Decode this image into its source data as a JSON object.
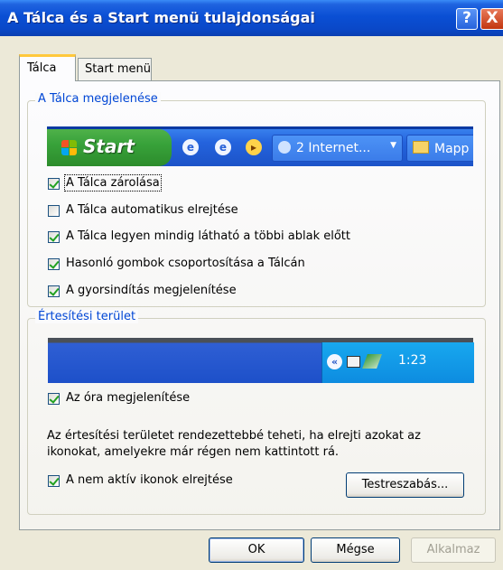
{
  "window": {
    "title": "A Tálca és a Start menü tulajdonságai",
    "help_glyph": "?",
    "close_glyph": "X"
  },
  "tabs": [
    {
      "label": "Tálca",
      "active": true
    },
    {
      "label": "Start menü",
      "active": false
    }
  ],
  "appearance_group": {
    "legend": "A Tálca megjelenése",
    "preview": {
      "start_label": "Start",
      "task_buttons": [
        "2 Internet...",
        "Mapp"
      ]
    },
    "options": [
      {
        "text": "A Tálca zárolása",
        "checked": true
      },
      {
        "text": "A Tálca automatikus elrejtése",
        "checked": false
      },
      {
        "text": "A Tálca legyen mindig látható a többi ablak előtt",
        "checked": true
      },
      {
        "text": "Hasonló gombok csoportosítása a Tálcán",
        "checked": true
      },
      {
        "text": "A gyorsindítás megjelenítése",
        "checked": true
      }
    ]
  },
  "notification_group": {
    "legend": "Értesítési terület",
    "preview": {
      "clock": "1:23",
      "chevron_glyph": "«"
    },
    "show_clock": {
      "text": "Az óra megjelenítése",
      "checked": true
    },
    "description": "Az értesítési területet rendezettebbé teheti, ha elrejti azokat az ikonokat, amelyekre már régen nem kattintott rá.",
    "hide_inactive": {
      "text": "A nem aktív ikonok elrejtése",
      "checked": true
    },
    "customize_button": "Testreszabás..."
  },
  "buttons": {
    "ok": "OK",
    "cancel": "Mégse",
    "apply": "Alkalmaz"
  }
}
